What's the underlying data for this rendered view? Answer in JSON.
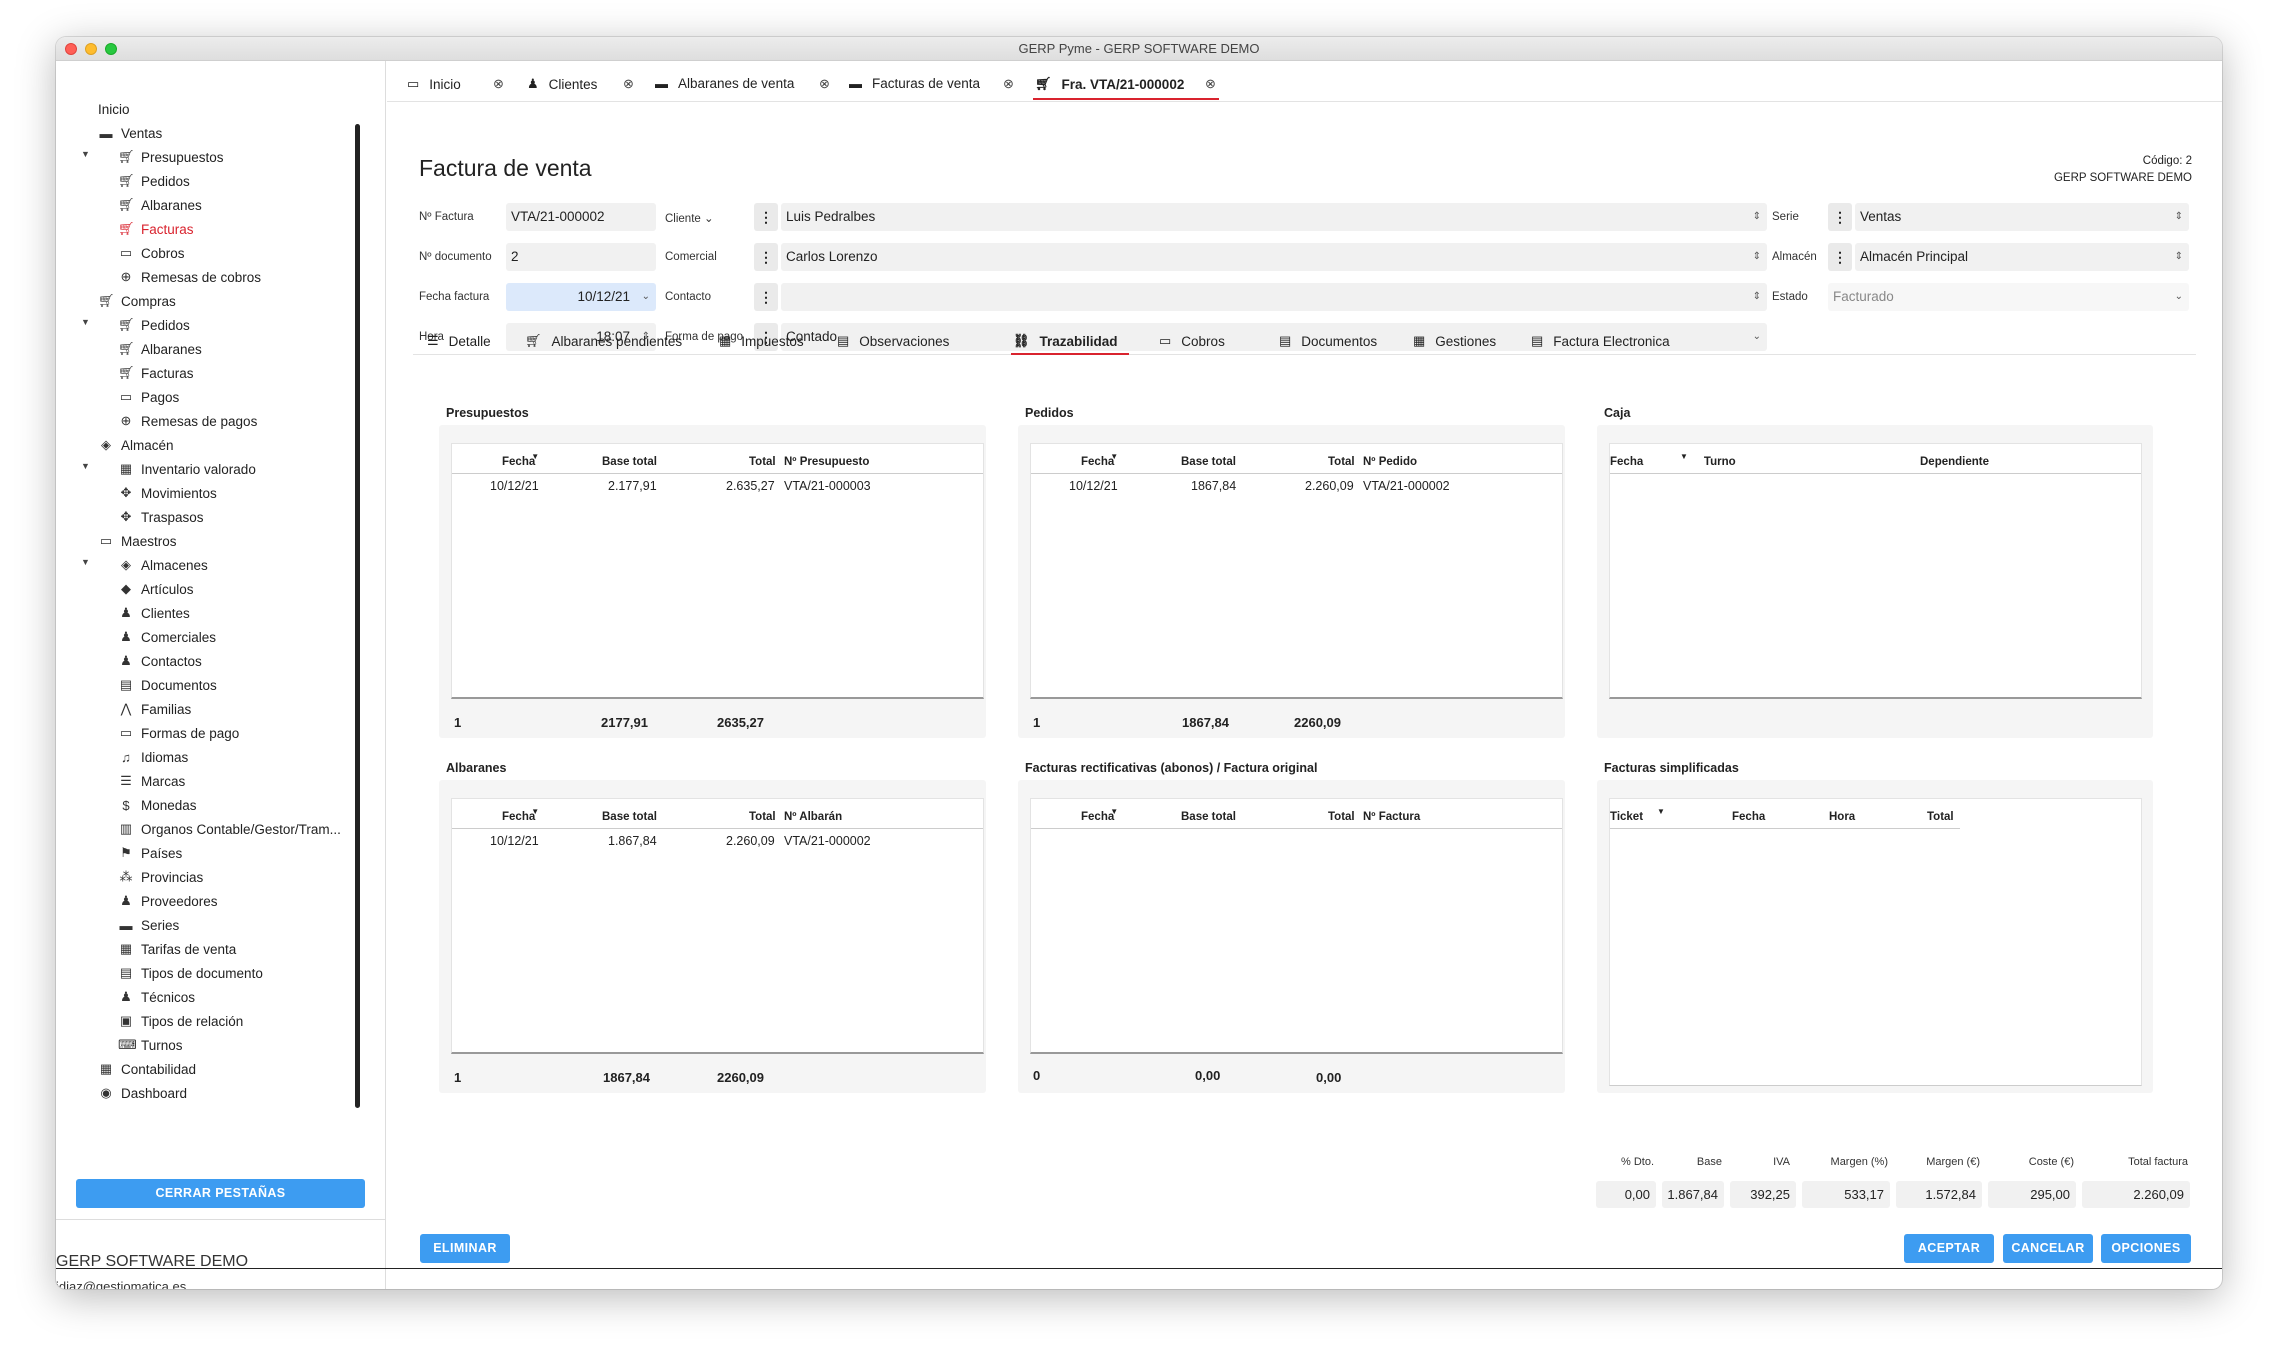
{
  "window": {
    "title": "GERP Pyme - GERP SOFTWARE DEMO"
  },
  "sidebar": {
    "items": [
      {
        "label": "Inicio",
        "icon": "none"
      },
      {
        "label": "Ventas",
        "icon": "card-icon"
      },
      {
        "label": "Presupuestos",
        "icon": "cart-icon"
      },
      {
        "label": "Pedidos",
        "icon": "cart-icon"
      },
      {
        "label": "Albaranes",
        "icon": "cart-icon"
      },
      {
        "label": "Facturas",
        "icon": "cart-icon"
      },
      {
        "label": "Cobros",
        "icon": "money-icon"
      },
      {
        "label": "Remesas de cobros",
        "icon": "remesa-icon"
      },
      {
        "label": "Compras",
        "icon": "cart-icon"
      },
      {
        "label": "Pedidos",
        "icon": "cart-icon"
      },
      {
        "label": "Albaranes",
        "icon": "cart-icon"
      },
      {
        "label": "Facturas",
        "icon": "cart-icon"
      },
      {
        "label": "Pagos",
        "icon": "money-icon"
      },
      {
        "label": "Remesas de pagos",
        "icon": "remesa-icon"
      },
      {
        "label": "Almacén",
        "icon": "box-icon"
      },
      {
        "label": "Inventario valorado",
        "icon": "inventory-icon"
      },
      {
        "label": "Movimientos",
        "icon": "move-icon"
      },
      {
        "label": "Traspasos",
        "icon": "move-icon"
      },
      {
        "label": "Maestros",
        "icon": "folder-icon"
      },
      {
        "label": "Almacenes",
        "icon": "box-icon"
      },
      {
        "label": "Artículos",
        "icon": "tag-icon"
      },
      {
        "label": "Clientes",
        "icon": "person-icon"
      },
      {
        "label": "Comerciales",
        "icon": "person-icon"
      },
      {
        "label": "Contactos",
        "icon": "person-icon"
      },
      {
        "label": "Documentos",
        "icon": "doc-icon"
      },
      {
        "label": "Familias",
        "icon": "family-icon"
      },
      {
        "label": "Formas de pago",
        "icon": "card-icon"
      },
      {
        "label": "Idiomas",
        "icon": "language-icon"
      },
      {
        "label": "Marcas",
        "icon": "list-icon"
      },
      {
        "label": "Monedas",
        "icon": "dollar-icon"
      },
      {
        "label": "Organos Contable/Gestor/Tram...",
        "icon": "building-icon"
      },
      {
        "label": "Países",
        "icon": "flag-icon"
      },
      {
        "label": "Provincias",
        "icon": "map-icon"
      },
      {
        "label": "Proveedores",
        "icon": "person-icon"
      },
      {
        "label": "Series",
        "icon": "folder-icon"
      },
      {
        "label": "Tarifas de venta",
        "icon": "calendar-icon"
      },
      {
        "label": "Tipos de documento",
        "icon": "doc-icon"
      },
      {
        "label": "Técnicos",
        "icon": "person-icon"
      },
      {
        "label": "Tipos de relación",
        "icon": "id-icon"
      },
      {
        "label": "Turnos",
        "icon": "keyboard-icon"
      },
      {
        "label": "Contabilidad",
        "icon": "calculator-icon"
      },
      {
        "label": "Dashboard",
        "icon": "eye-icon"
      }
    ],
    "close_tabs": "CERRAR PESTAÑAS",
    "company": "GERP SOFTWARE DEMO",
    "email": "jdiaz@gestiomatica.es"
  },
  "tabs": [
    {
      "label": "Inicio",
      "icon": "folder-icon"
    },
    {
      "label": "Clientes",
      "icon": "person-icon"
    },
    {
      "label": "Albaranes de venta",
      "icon": "card-icon"
    },
    {
      "label": "Facturas de venta",
      "icon": "card-icon"
    },
    {
      "label": "Fra. VTA/21-000002",
      "icon": "cart-icon",
      "active": true
    }
  ],
  "header": {
    "title": "Factura de venta",
    "code": "Código: 2",
    "company": "GERP SOFTWARE DEMO"
  },
  "form": {
    "numero_factura": {
      "label": "Nº Factura",
      "value": "VTA/21-000002"
    },
    "numero_documento": {
      "label": "Nº documento",
      "value": "2"
    },
    "fecha_factura": {
      "label": "Fecha factura",
      "value": "10/12/21"
    },
    "hora": {
      "label": "Hora",
      "value": "18:07"
    },
    "cliente": {
      "label": "Cliente",
      "value": "Luis Pedralbes"
    },
    "comercial": {
      "label": "Comercial",
      "value": "Carlos Lorenzo"
    },
    "contacto": {
      "label": "Contacto",
      "value": ""
    },
    "forma_pago": {
      "label": "Forma de pago",
      "value": "Contado"
    },
    "serie": {
      "label": "Serie",
      "value": "Ventas"
    },
    "almacen": {
      "label": "Almacén",
      "value": "Almacén Principal"
    },
    "estado": {
      "label": "Estado",
      "value": "Facturado"
    }
  },
  "subtabs": [
    {
      "label": "Detalle",
      "icon": "list-icon"
    },
    {
      "label": "Albaranes pendientes",
      "icon": "cart-icon"
    },
    {
      "label": "Impuestos",
      "icon": "calculator-icon"
    },
    {
      "label": "Observaciones",
      "icon": "note-icon"
    },
    {
      "label": "Trazabilidad",
      "icon": "tree-icon",
      "active": true
    },
    {
      "label": "Cobros",
      "icon": "money-icon"
    },
    {
      "label": "Documentos",
      "icon": "doc-icon"
    },
    {
      "label": "Gestiones",
      "icon": "calendar-icon"
    },
    {
      "label": "Factura Electronica",
      "icon": "note-icon"
    }
  ],
  "sections": {
    "presupuestos": {
      "title": "Presupuestos",
      "columns": [
        "Fecha",
        "Base total",
        "Total",
        "Nº Presupuesto"
      ],
      "rows": [
        [
          "10/12/21",
          "2.177,91",
          "2.635,27",
          "VTA/21-000003"
        ]
      ],
      "footer": [
        "1",
        "2177,91",
        "2635,27"
      ]
    },
    "pedidos": {
      "title": "Pedidos",
      "columns": [
        "Fecha",
        "Base total",
        "Total",
        "Nº Pedido"
      ],
      "rows": [
        [
          "10/12/21",
          "1867,84",
          "2.260,09",
          "VTA/21-000002"
        ]
      ],
      "footer": [
        "1",
        "1867,84",
        "2260,09"
      ]
    },
    "caja": {
      "title": "Caja",
      "columns": [
        "Fecha",
        "Turno",
        "Dependiente"
      ]
    },
    "albaranes": {
      "title": "Albaranes",
      "columns": [
        "Fecha",
        "Base total",
        "Total",
        "Nº Albarán"
      ],
      "rows": [
        [
          "10/12/21",
          "1.867,84",
          "2.260,09",
          "VTA/21-000002"
        ]
      ],
      "footer": [
        "1",
        "1867,84",
        "2260,09"
      ]
    },
    "rectificativas": {
      "title": "Facturas rectificativas (abonos) / Factura original",
      "columns": [
        "Fecha",
        "Base total",
        "Total",
        "Nº Factura"
      ],
      "footer": [
        "0",
        "0,00",
        "0,00"
      ]
    },
    "simplificadas": {
      "title": "Facturas simplificadas",
      "columns": [
        "Ticket",
        "Fecha",
        "Hora",
        "Total"
      ]
    }
  },
  "totals": [
    {
      "label": "% Dto.",
      "value": "0,00"
    },
    {
      "label": "Base",
      "value": "1.867,84"
    },
    {
      "label": "IVA",
      "value": "392,25"
    },
    {
      "label": "Margen (%)",
      "value": "533,17"
    },
    {
      "label": "Margen (€)",
      "value": "1.572,84"
    },
    {
      "label": "Coste (€)",
      "value": "295,00"
    },
    {
      "label": "Total factura",
      "value": "2.260,09"
    }
  ],
  "buttons": {
    "eliminar": "ELIMINAR",
    "aceptar": "ACEPTAR",
    "cancelar": "CANCELAR",
    "opciones": "OPCIONES"
  },
  "colors": {
    "accent": "#3d9cf1",
    "selected": "#d9232e"
  }
}
